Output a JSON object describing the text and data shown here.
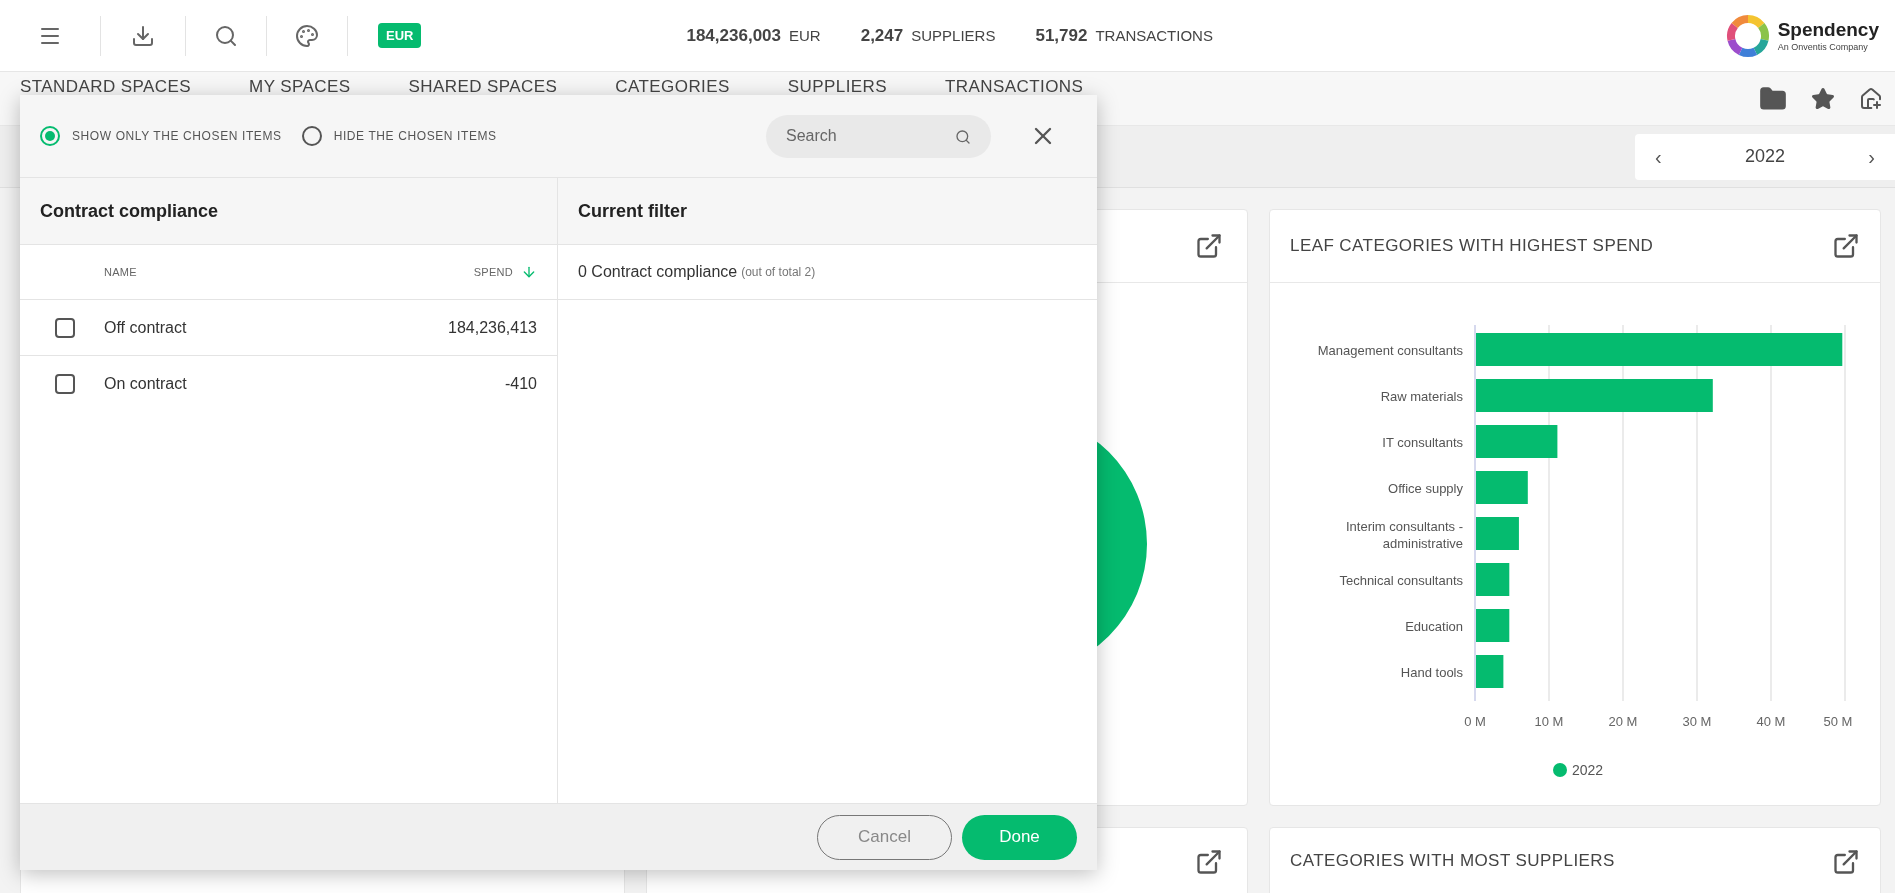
{
  "toolbar": {
    "currency": "EUR",
    "stats": [
      {
        "value": "184,236,003",
        "unit": "EUR"
      },
      {
        "value": "2,247",
        "unit": "SUPPLIERS"
      },
      {
        "value": "51,792",
        "unit": "TRANSACTIONS"
      }
    ],
    "logo": {
      "name": "Spendency",
      "tagline": "An Onventis Company"
    }
  },
  "nav_tabs": [
    {
      "label": "STANDARD SPACES"
    },
    {
      "label": "MY SPACES"
    },
    {
      "label": "SHARED SPACES"
    },
    {
      "label": "CATEGORIES"
    },
    {
      "label": "SUPPLIERS"
    },
    {
      "label": "TRANSACTIONS"
    }
  ],
  "year_selector": {
    "prev": "‹",
    "value": "2022",
    "next": "›"
  },
  "cards": [
    {
      "title": "LEAF CATEGORIES WITH HIGHEST SPEND",
      "chart_data": {
        "type": "bar",
        "orientation": "horizontal",
        "categories": [
          "Management consultants",
          "Raw materials",
          "IT consultants",
          "Office supply",
          "Interim consultants - administrative",
          "Technical consultants",
          "Education",
          "Hand tools"
        ],
        "series": [
          {
            "name": "2022",
            "color": "#05bb6f",
            "values": [
              49.5,
              32,
              11,
              7,
              5.8,
              4.5,
              4.5,
              3.7
            ]
          }
        ],
        "xlim": [
          0,
          50
        ],
        "grid": true,
        "xticks": [
          {
            "value": 0,
            "label": "0 M"
          },
          {
            "value": 10,
            "label": "10 M"
          },
          {
            "value": 20,
            "label": "20 M"
          },
          {
            "value": 30,
            "label": "30 M"
          },
          {
            "value": 40,
            "label": "40 M"
          },
          {
            "value": 50,
            "label": "50 M"
          }
        ]
      }
    },
    {
      "title": "CATEGORIES WITH MOST SUPPLIERS"
    }
  ],
  "filter_dialog": {
    "modes": [
      {
        "label": "SHOW ONLY THE CHOSEN ITEMS",
        "selected": true
      },
      {
        "label": "HIDE THE CHOSEN ITEMS",
        "selected": false
      }
    ],
    "search": {
      "placeholder": "Search"
    },
    "list_title": "Contract compliance",
    "columns": [
      "NAME",
      "SPEND"
    ],
    "rows": [
      {
        "name": "Off contract",
        "spend": "184,236,413",
        "checked": false
      },
      {
        "name": "On contract",
        "spend": "-410",
        "checked": false
      }
    ],
    "filter_title": "Current filter",
    "filter_summary": "0 Contract compliance",
    "filter_note": "(out of total 2)",
    "buttons": {
      "cancel": "Cancel",
      "done": "Done"
    }
  }
}
